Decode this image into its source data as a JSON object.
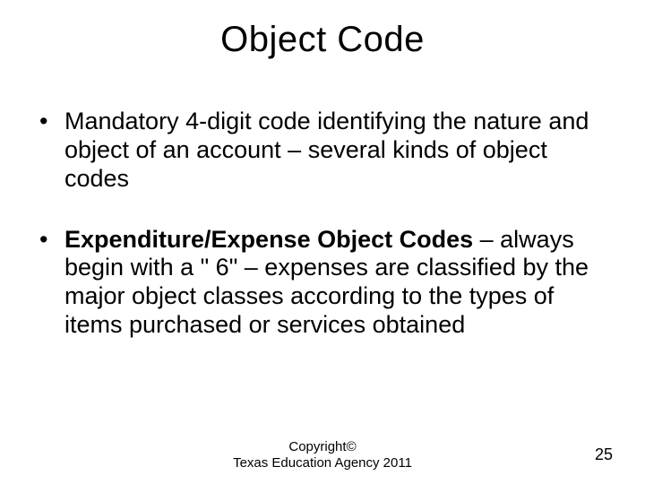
{
  "title": "Object Code",
  "bullets": [
    {
      "boldLead": "",
      "text": "Mandatory 4-digit code identifying the nature and object of an account – several kinds of object codes"
    },
    {
      "boldLead": "Expenditure/Expense Object Codes",
      "text": " – always begin with a \" 6\" – expenses are classified by the major object classes according to the types of items purchased or services obtained"
    }
  ],
  "footer": {
    "line1": "Copyright©",
    "line2": "Texas Education Agency 2011"
  },
  "pageNumber": "25"
}
